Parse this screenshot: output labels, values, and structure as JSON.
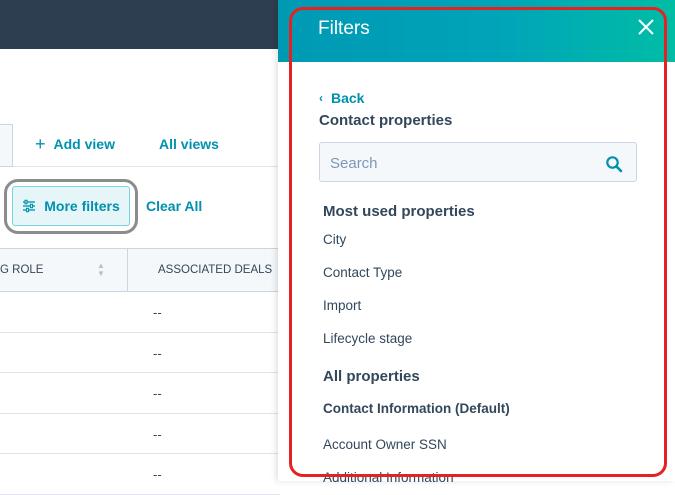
{
  "toolbar": {
    "add_view_label": "Add view",
    "all_views_label": "All views",
    "more_filters_label": "More filters",
    "clear_all_label": "Clear All"
  },
  "table": {
    "columns": [
      "G ROLE",
      "ASSOCIATED DEALS"
    ],
    "rows": [
      "--",
      "--",
      "--",
      "--",
      "--"
    ]
  },
  "filters_panel": {
    "title": "Filters",
    "back_label": "Back",
    "section_title": "Contact properties",
    "search_placeholder": "Search",
    "most_used_heading": "Most used properties",
    "most_used": [
      "City",
      "Contact Type",
      "Import",
      "Lifecycle stage"
    ],
    "all_properties_heading": "All properties",
    "group_heading": "Contact Information (Default)",
    "all_properties": [
      "Account Owner SSN",
      "Additional Information"
    ]
  },
  "colors": {
    "accent": "#0091ae",
    "header_gradient_start": "#0099b4",
    "header_gradient_end": "#00bda5",
    "highlight_border": "#e52222",
    "topbar": "#2d3e50"
  }
}
